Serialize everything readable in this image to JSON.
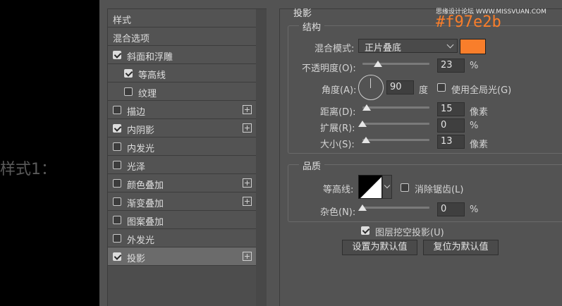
{
  "left": {
    "caption": "样式1："
  },
  "styles_list": {
    "items": [
      {
        "label": "样式",
        "checkbox": false,
        "checked": false,
        "plus": false,
        "selected": false
      },
      {
        "label": "混合选项",
        "checkbox": false,
        "checked": false,
        "plus": false,
        "selected": false
      },
      {
        "label": "斜面和浮雕",
        "checkbox": true,
        "checked": true,
        "plus": false,
        "selected": false
      },
      {
        "label": "等高线",
        "checkbox": true,
        "checked": true,
        "plus": false,
        "selected": false
      },
      {
        "label": "纹理",
        "checkbox": true,
        "checked": false,
        "plus": false,
        "selected": false
      },
      {
        "label": "描边",
        "checkbox": true,
        "checked": false,
        "plus": true,
        "selected": false
      },
      {
        "label": "内阴影",
        "checkbox": true,
        "checked": true,
        "plus": true,
        "selected": false
      },
      {
        "label": "内发光",
        "checkbox": true,
        "checked": false,
        "plus": false,
        "selected": false
      },
      {
        "label": "光泽",
        "checkbox": true,
        "checked": false,
        "plus": false,
        "selected": false
      },
      {
        "label": "颜色叠加",
        "checkbox": true,
        "checked": false,
        "plus": true,
        "selected": false
      },
      {
        "label": "渐变叠加",
        "checkbox": true,
        "checked": false,
        "plus": true,
        "selected": false
      },
      {
        "label": "图案叠加",
        "checkbox": true,
        "checked": false,
        "plus": false,
        "selected": false
      },
      {
        "label": "外发光",
        "checkbox": true,
        "checked": false,
        "plus": false,
        "selected": false
      },
      {
        "label": "投影",
        "checkbox": true,
        "checked": true,
        "plus": true,
        "selected": true
      }
    ]
  },
  "settings": {
    "section_title": "投影",
    "structure": {
      "title": "结构",
      "blend_mode_label": "混合模式:",
      "blend_mode_value": "正片叠底",
      "color": "#f97e2b",
      "opacity_label": "不透明度(O):",
      "opacity_value": "23",
      "opacity_unit": "%",
      "opacity_fraction": 0.23,
      "angle_label": "角度(A):",
      "angle_value": "90",
      "angle_unit": "度",
      "global_light_label": "使用全局光(G)",
      "global_light_checked": false,
      "distance_label": "距离(D):",
      "distance_value": "15",
      "distance_unit": "像素",
      "distance_fraction": 0.06,
      "spread_label": "扩展(R):",
      "spread_value": "0",
      "spread_unit": "%",
      "spread_fraction": 0.0,
      "size_label": "大小(S):",
      "size_value": "13",
      "size_unit": "像素",
      "size_fraction": 0.05
    },
    "quality": {
      "title": "品质",
      "contour_label": "等高线:",
      "anti_alias_label": "消除锯齿(L)",
      "anti_alias_checked": false,
      "noise_label": "杂色(N):",
      "noise_value": "0",
      "noise_unit": "%",
      "noise_fraction": 0.0
    },
    "knockout_label": "图层挖空投影(U)",
    "knockout_checked": true,
    "set_default_label": "设置为默认值",
    "reset_default_label": "复位为默认值"
  },
  "annotation": {
    "hex_text": "#f97e2b",
    "hex_color": "#f97e2b",
    "watermark": "思缘设计论坛 WWW.MISSVUAN.COM"
  }
}
